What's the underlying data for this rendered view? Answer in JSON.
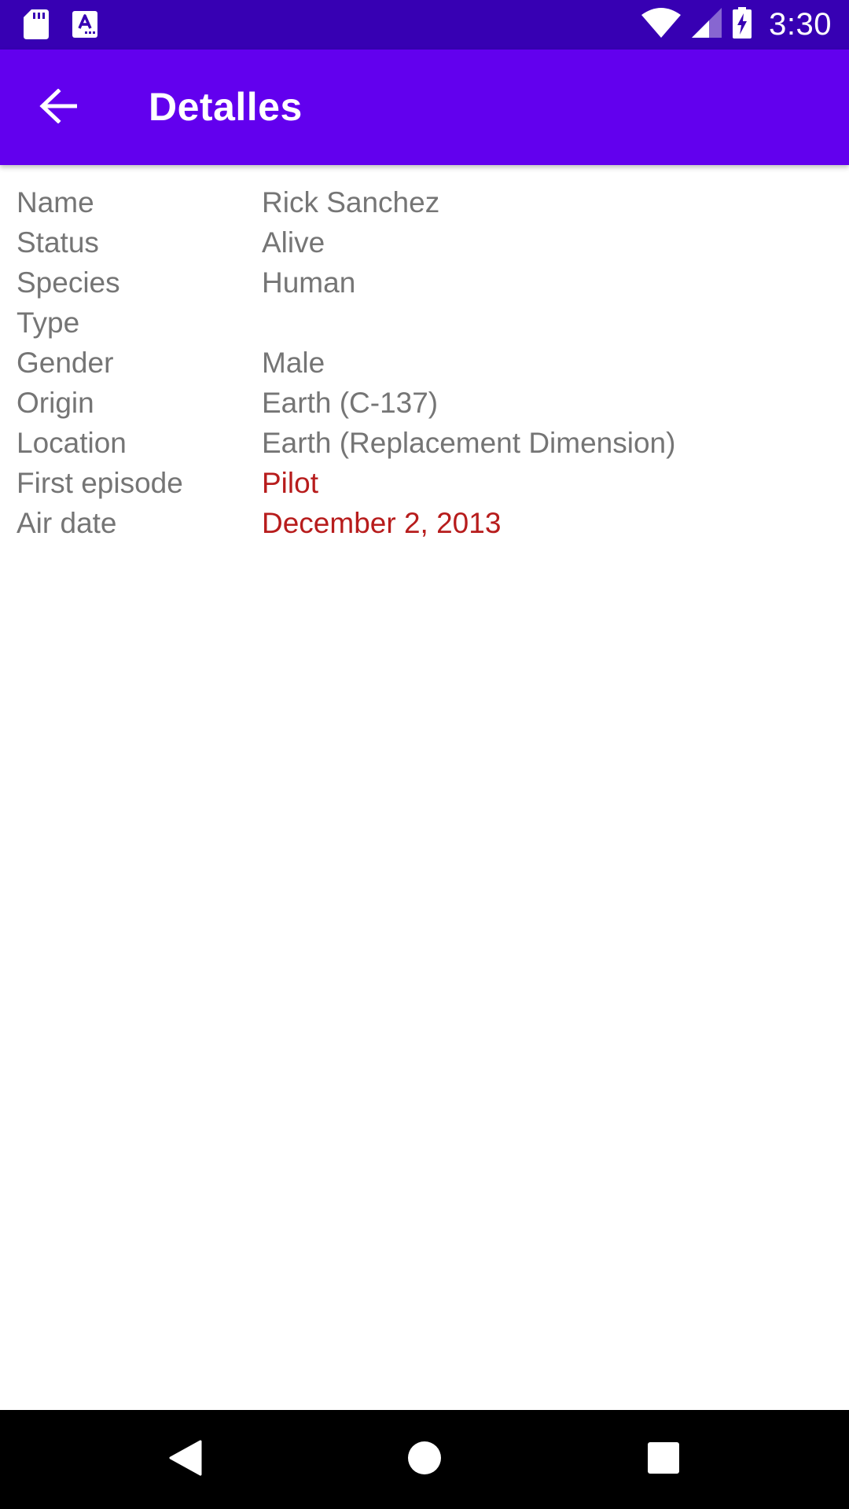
{
  "status_bar": {
    "time": "3:30",
    "icons": [
      "sd-card-icon",
      "text-notification-icon",
      "wifi-icon",
      "cellular-signal-icon",
      "battery-charging-icon"
    ]
  },
  "app_bar": {
    "title": "Detalles",
    "back_icon": "arrow-back-icon",
    "color": "#6200ee"
  },
  "details": {
    "rows": [
      {
        "label": "Name",
        "value": "Rick Sanchez"
      },
      {
        "label": "Status",
        "value": "Alive"
      },
      {
        "label": "Species",
        "value": "Human"
      },
      {
        "label": "Type",
        "value": ""
      },
      {
        "label": "Gender",
        "value": "Male"
      },
      {
        "label": "Origin",
        "value": "Earth (C-137)"
      },
      {
        "label": "Location",
        "value": "Earth (Replacement Dimension)"
      },
      {
        "label": "First episode",
        "value": "Pilot"
      },
      {
        "label": "Air date",
        "value": "December 2, 2013"
      }
    ]
  },
  "nav_bar": {
    "icons": [
      "back-triangle-icon",
      "home-circle-icon",
      "recents-square-icon"
    ]
  },
  "colors": {
    "status_bar": "#3700b3",
    "app_bar": "#6200ee",
    "label_text": "#757575",
    "link_text": "#b71c1c"
  }
}
